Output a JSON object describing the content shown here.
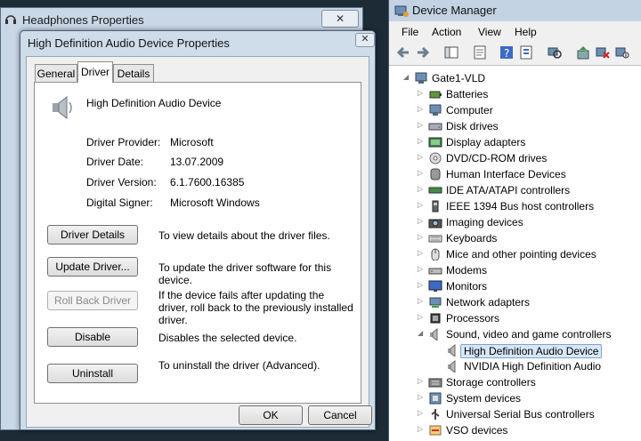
{
  "back_window": {
    "title": "Headphones Properties",
    "close": "✕"
  },
  "dialog": {
    "title": "High Definition Audio Device Properties",
    "close": "✕",
    "tabs": [
      {
        "label": "General"
      },
      {
        "label": "Driver",
        "active": true
      },
      {
        "label": "Details"
      }
    ],
    "device_name": "High Definition Audio Device",
    "info": [
      {
        "label": "Driver Provider:",
        "value": "Microsoft"
      },
      {
        "label": "Driver Date:",
        "value": "13.07.2009"
      },
      {
        "label": "Driver Version:",
        "value": "6.1.7600.16385"
      },
      {
        "label": "Digital Signer:",
        "value": "Microsoft Windows"
      }
    ],
    "actions": [
      {
        "button": "Driver Details",
        "desc": "To view details about the driver files.",
        "enabled": true
      },
      {
        "button": "Update Driver...",
        "desc": "To update the driver software for this device.",
        "enabled": true
      },
      {
        "button": "Roll Back Driver",
        "desc": "If the device fails after updating the driver, roll back to the previously installed driver.",
        "enabled": false
      },
      {
        "button": "Disable",
        "desc": "Disables the selected device.",
        "enabled": true
      },
      {
        "button": "Uninstall",
        "desc": "To uninstall the driver (Advanced).",
        "enabled": true
      }
    ],
    "ok": "OK",
    "cancel": "Cancel"
  },
  "device_manager": {
    "title": "Device Manager",
    "menu": [
      "File",
      "Action",
      "View",
      "Help"
    ],
    "toolbar_icons": [
      "back-arrow-icon",
      "forward-arrow-icon",
      "show-hide-tree-icon",
      "properties-icon",
      "help-icon",
      "action-icon",
      "scan-hardware-icon",
      "update-driver-icon",
      "uninstall-icon",
      "disable-icon"
    ],
    "root": "Gate1-VLD",
    "nodes": [
      {
        "label": "Batteries",
        "icon": "battery-icon"
      },
      {
        "label": "Computer",
        "icon": "computer-icon"
      },
      {
        "label": "Disk drives",
        "icon": "disk-icon"
      },
      {
        "label": "Display adapters",
        "icon": "display-icon"
      },
      {
        "label": "DVD/CD-ROM drives",
        "icon": "dvd-icon"
      },
      {
        "label": "Human Interface Devices",
        "icon": "hid-icon"
      },
      {
        "label": "IDE ATA/ATAPI controllers",
        "icon": "ide-icon"
      },
      {
        "label": "IEEE 1394 Bus host controllers",
        "icon": "firewire-icon"
      },
      {
        "label": "Imaging devices",
        "icon": "camera-icon"
      },
      {
        "label": "Keyboards",
        "icon": "keyboard-icon"
      },
      {
        "label": "Mice and other pointing devices",
        "icon": "mouse-icon"
      },
      {
        "label": "Modems",
        "icon": "modem-icon"
      },
      {
        "label": "Monitors",
        "icon": "monitor-icon"
      },
      {
        "label": "Network adapters",
        "icon": "network-icon"
      },
      {
        "label": "Processors",
        "icon": "processor-icon"
      },
      {
        "label": "Sound, video and game controllers",
        "icon": "speaker-icon",
        "expanded": true,
        "children": [
          {
            "label": "High Definition Audio Device",
            "icon": "speaker-icon",
            "selected": true
          },
          {
            "label": "NVIDIA High Definition Audio",
            "icon": "speaker-icon"
          }
        ]
      },
      {
        "label": "Storage controllers",
        "icon": "storage-icon"
      },
      {
        "label": "System devices",
        "icon": "system-icon"
      },
      {
        "label": "Universal Serial Bus controllers",
        "icon": "usb-icon"
      },
      {
        "label": "VSO devices",
        "icon": "vso-icon"
      }
    ]
  },
  "colors": {
    "selection": "#d8e7f8",
    "selection_border": "#7da2ce",
    "frame": "#c3d3e3"
  }
}
